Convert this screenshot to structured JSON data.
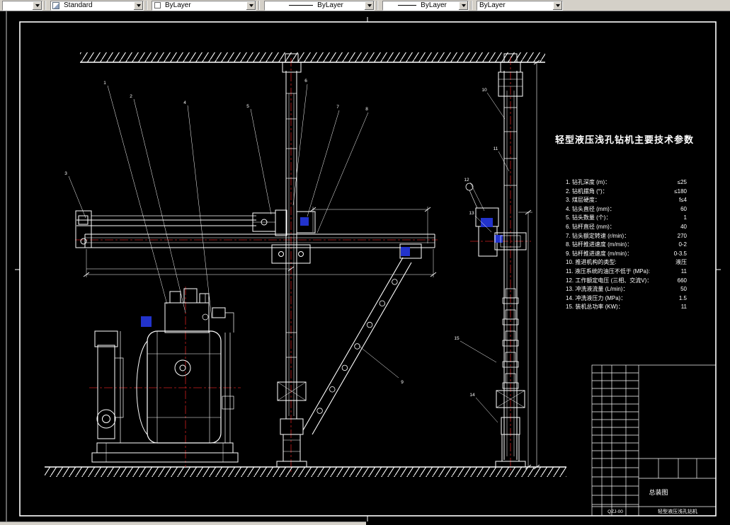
{
  "toolbar": {
    "layer_value": "",
    "style_label": "Standard",
    "color_label": "ByLayer",
    "linetype_label": "ByLayer",
    "lineweight_label": "ByLayer",
    "plotstyle_label": "ByLayer"
  },
  "colors": {
    "canvas_bg": "#000000",
    "line": "#ffffff",
    "centerline_red": "#cc2020",
    "accent_blue": "#2233cc",
    "toolbar_bg": "#d4d0c8"
  },
  "drawing": {
    "params_title": "轻型液压浅孔钻机主要技术参数",
    "params": [
      {
        "label": "1.  钻孔深度 (m)：",
        "value": "≤25"
      },
      {
        "label": "2.  钻机摆角 (°)：",
        "value": "≤180"
      },
      {
        "label": "3.  煤层硬度：",
        "value": "f≤4"
      },
      {
        "label": "4.  钻头直径 (mm)：",
        "value": "60"
      },
      {
        "label": "5.  钻头数量 (个)：",
        "value": "1"
      },
      {
        "label": "6.  钻杆直径 (mm)：",
        "value": "40"
      },
      {
        "label": "7.  钻头额定转速 (r/min)：",
        "value": "270"
      },
      {
        "label": "8.  钻杆推进速度 (m/min)：",
        "value": "0-2"
      },
      {
        "label": "9.  钻杆推进速度 (m/min)：",
        "value": "0-3.5"
      },
      {
        "label": "10. 推进机构的类型:",
        "value": "液压"
      },
      {
        "label": "11. 液压系统的油压不低于 (MPa):",
        "value": "11"
      },
      {
        "label": "12. 工作额定电压 (三相、交流V)：",
        "value": "660"
      },
      {
        "label": "13. 冲洗液流量 (L/min)：",
        "value": "50"
      },
      {
        "label": "14. 冲洗液压力 (MPa)：",
        "value": "1.5"
      },
      {
        "label": "15. 装机总功率 (KW)：",
        "value": "11"
      }
    ],
    "callouts": [
      "1",
      "2",
      "3",
      "4",
      "5",
      "6",
      "7",
      "8",
      "9",
      "10",
      "11",
      "12",
      "13",
      "14",
      "15"
    ],
    "title_block": {
      "drawing_type": "总装图",
      "drawing_no": "QZJ-00",
      "product_name": "轻型液压浅孔钻机"
    }
  }
}
